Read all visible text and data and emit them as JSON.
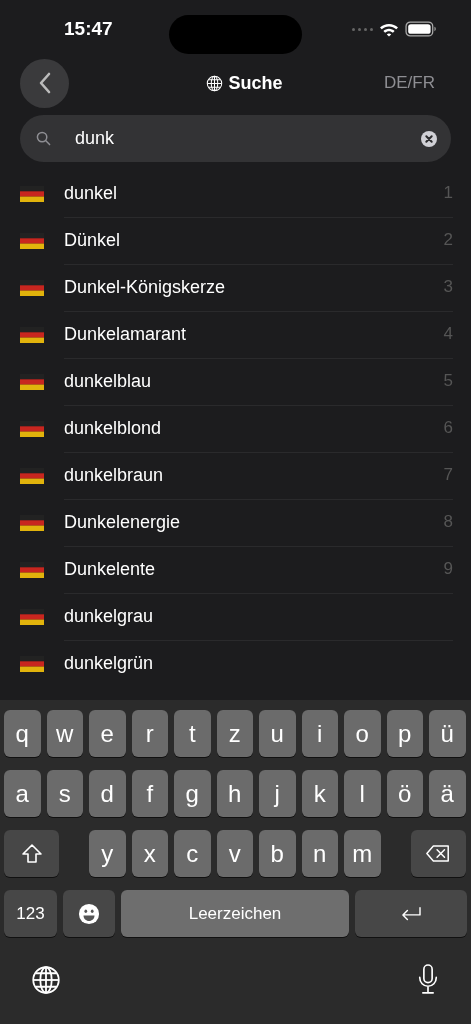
{
  "status_bar": {
    "time": "15:47"
  },
  "nav": {
    "title": "Suche",
    "language_toggle": "DE/FR"
  },
  "search": {
    "value": "dunk"
  },
  "results": [
    {
      "word": "dunkel",
      "number": "1"
    },
    {
      "word": "Dünkel",
      "number": "2"
    },
    {
      "word": "Dunkel-Königskerze",
      "number": "3"
    },
    {
      "word": "Dunkelamarant",
      "number": "4"
    },
    {
      "word": "dunkelblau",
      "number": "5"
    },
    {
      "word": "dunkelblond",
      "number": "6"
    },
    {
      "word": "dunkelbraun",
      "number": "7"
    },
    {
      "word": "Dunkelenergie",
      "number": "8"
    },
    {
      "word": "Dunkelente",
      "number": "9"
    },
    {
      "word": "dunkelgrau"
    },
    {
      "word": "dunkelgrün"
    }
  ],
  "keyboard": {
    "rows": [
      [
        {
          "kind": "letter",
          "label": "q"
        },
        {
          "kind": "letter",
          "label": "w"
        },
        {
          "kind": "letter",
          "label": "e"
        },
        {
          "kind": "letter",
          "label": "r"
        },
        {
          "kind": "letter",
          "label": "t"
        },
        {
          "kind": "letter",
          "label": "z"
        },
        {
          "kind": "letter",
          "label": "u"
        },
        {
          "kind": "letter",
          "label": "i"
        },
        {
          "kind": "letter",
          "label": "o"
        },
        {
          "kind": "letter",
          "label": "p"
        },
        {
          "kind": "letter",
          "label": "ü"
        }
      ],
      [
        {
          "kind": "letter",
          "label": "a"
        },
        {
          "kind": "letter",
          "label": "s"
        },
        {
          "kind": "letter",
          "label": "d"
        },
        {
          "kind": "letter",
          "label": "f"
        },
        {
          "kind": "letter",
          "label": "g"
        },
        {
          "kind": "letter",
          "label": "h"
        },
        {
          "kind": "letter",
          "label": "j"
        },
        {
          "kind": "letter",
          "label": "k"
        },
        {
          "kind": "letter",
          "label": "l"
        },
        {
          "kind": "letter",
          "label": "ö"
        },
        {
          "kind": "letter",
          "label": "ä"
        }
      ],
      [
        {
          "kind": "shift"
        },
        "",
        {
          "kind": "letter",
          "label": "y"
        },
        {
          "kind": "letter",
          "label": "x"
        },
        {
          "kind": "letter",
          "label": "c"
        },
        {
          "kind": "letter",
          "label": "v"
        },
        {
          "kind": "letter",
          "label": "b"
        },
        {
          "kind": "letter",
          "label": "n"
        },
        {
          "kind": "letter",
          "label": "m"
        },
        "",
        {
          "kind": "delete"
        }
      ]
    ],
    "bottom_row": [
      {
        "kind": "numbers",
        "label": "123"
      },
      {
        "kind": "emoji"
      },
      {
        "kind": "space",
        "label": "Leerzeichen"
      },
      {
        "kind": "return"
      }
    ]
  }
}
